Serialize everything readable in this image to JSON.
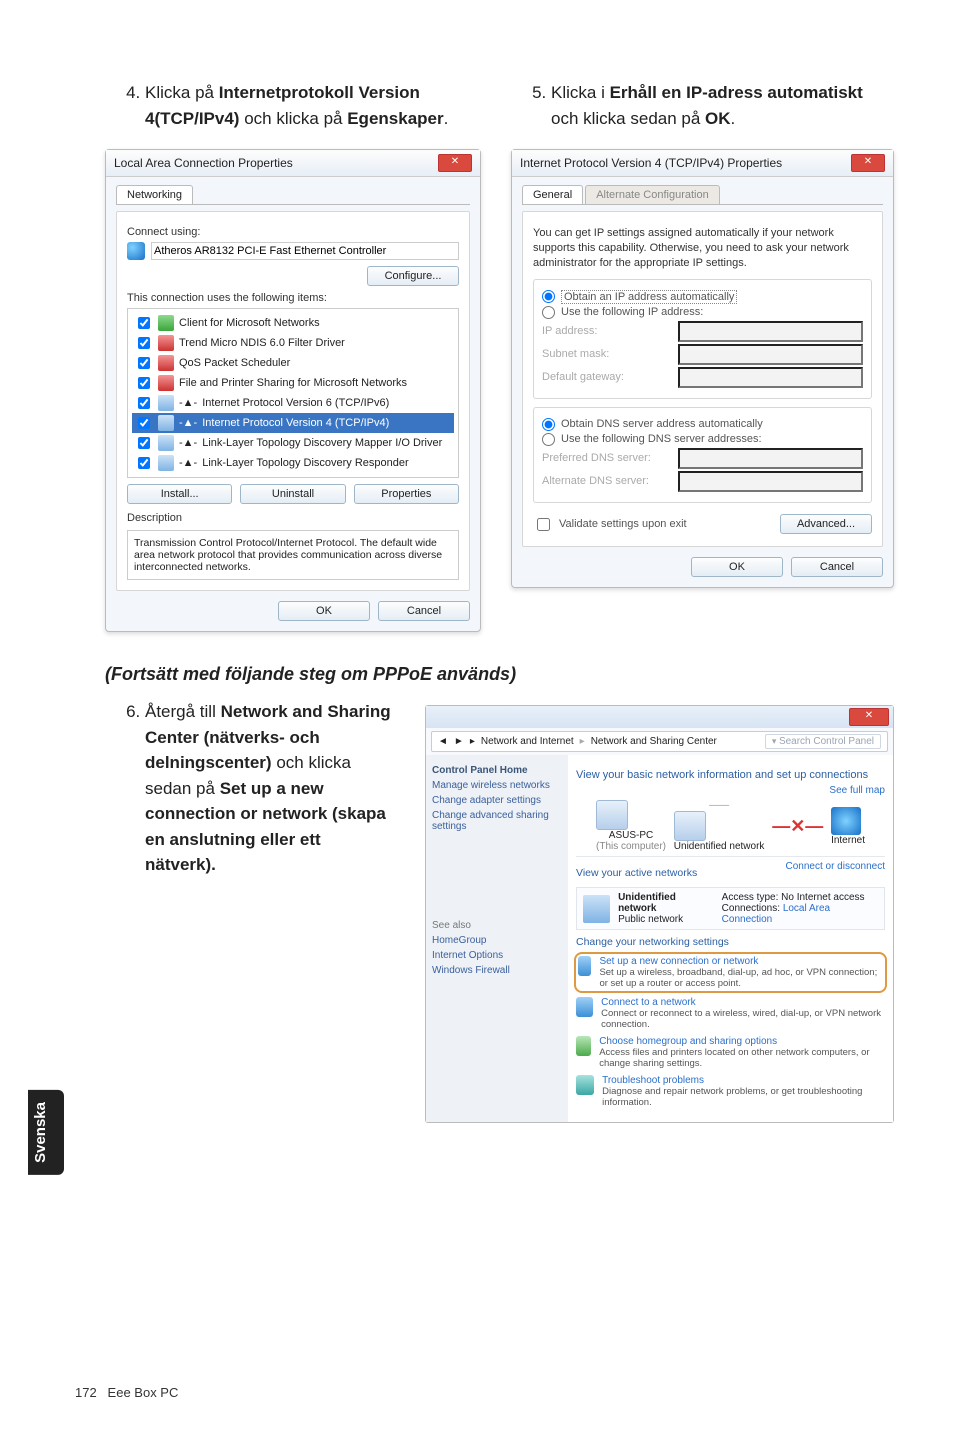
{
  "lang_tab": "Svenska",
  "step4": {
    "num": "4.",
    "text_pre": "Klicka på ",
    "b1": "Internetprotokoll Version 4(TCP/IPv4)",
    "mid": " och klicka på ",
    "b2": "Egenskaper",
    "post": "."
  },
  "step5": {
    "num": "5.",
    "text_pre": "Klicka i ",
    "b1": "Erhåll en IP-adress automatiskt",
    "mid": " och klicka sedan på ",
    "b2": "OK",
    "post": "."
  },
  "step6": {
    "num": "6.",
    "pre": "Återgå till ",
    "b1": "Network and Sharing Center (nätverks- och delningscenter)",
    "mid": " och klicka sedan på ",
    "b2": "Set up a new connection or network (skapa en anslutning eller ett nätverk).",
    "post": ""
  },
  "section_title": "(Fortsätt med följande steg om PPPoE används)",
  "lac": {
    "title": "Local Area Connection Properties",
    "tab": "Networking",
    "connect_using": "Connect using:",
    "adapter": "Atheros AR8132 PCI-E Fast Ethernet Controller",
    "configure": "Configure...",
    "uses_label": "This connection uses the following items:",
    "items": [
      "Client for Microsoft Networks",
      "Trend Micro NDIS 6.0 Filter Driver",
      "QoS Packet Scheduler",
      "File and Printer Sharing for Microsoft Networks",
      "Internet Protocol Version 6 (TCP/IPv6)",
      "Internet Protocol Version 4 (TCP/IPv4)",
      "Link-Layer Topology Discovery Mapper I/O Driver",
      "Link-Layer Topology Discovery Responder"
    ],
    "install": "Install...",
    "uninstall": "Uninstall",
    "props": "Properties",
    "desc_title": "Description",
    "desc": "Transmission Control Protocol/Internet Protocol. The default wide area network protocol that provides communication across diverse interconnected networks.",
    "ok": "OK",
    "cancel": "Cancel"
  },
  "ipv4": {
    "title": "Internet Protocol Version 4 (TCP/IPv4) Properties",
    "tab1": "General",
    "tab2": "Alternate Configuration",
    "intro": "You can get IP settings assigned automatically if your network supports this capability. Otherwise, you need to ask your network administrator for the appropriate IP settings.",
    "r1": "Obtain an IP address automatically",
    "r2": "Use the following IP address:",
    "f1": "IP address:",
    "f2": "Subnet mask:",
    "f3": "Default gateway:",
    "r3": "Obtain DNS server address automatically",
    "r4": "Use the following DNS server addresses:",
    "f4": "Preferred DNS server:",
    "f5": "Alternate DNS server:",
    "validate": "Validate settings upon exit",
    "adv": "Advanced...",
    "ok": "OK",
    "cancel": "Cancel"
  },
  "nsc": {
    "addr1": "Network and Internet",
    "addr2": "Network and Sharing Center",
    "search": "Search Control Panel",
    "side_title": "Control Panel Home",
    "side": [
      "Manage wireless networks",
      "Change adapter settings",
      "Change advanced sharing settings"
    ],
    "side_also": "See also",
    "side_also_items": [
      "HomeGroup",
      "Internet Options",
      "Windows Firewall"
    ],
    "hdr1": "View your basic network information and set up connections",
    "map_left": "ASUS-PC",
    "map_left_sub": "(This computer)",
    "map_mid": "Unidentified network",
    "map_right": "Internet",
    "full_map": "See full map",
    "connect_or": "Connect or disconnect",
    "active_title": "View your active networks",
    "net_name": "Unidentified network",
    "net_type": "Public network",
    "acc": "Access type:",
    "acc_v": "No Internet access",
    "conn": "Connections:",
    "conn_v": "Local Area Connection",
    "chg": "Change your networking settings",
    "t1": "Set up a new connection or network",
    "t1d": "Set up a wireless, broadband, dial-up, ad hoc, or VPN connection; or set up a router or access point.",
    "t2": "Connect to a network",
    "t2d": "Connect or reconnect to a wireless, wired, dial-up, or VPN network connection.",
    "t3": "Choose homegroup and sharing options",
    "t3d": "Access files and printers located on other network computers, or change sharing settings.",
    "t4": "Troubleshoot problems",
    "t4d": "Diagnose and repair network problems, or get troubleshooting information."
  },
  "footer": {
    "page": "172",
    "title": "Eee Box PC"
  }
}
